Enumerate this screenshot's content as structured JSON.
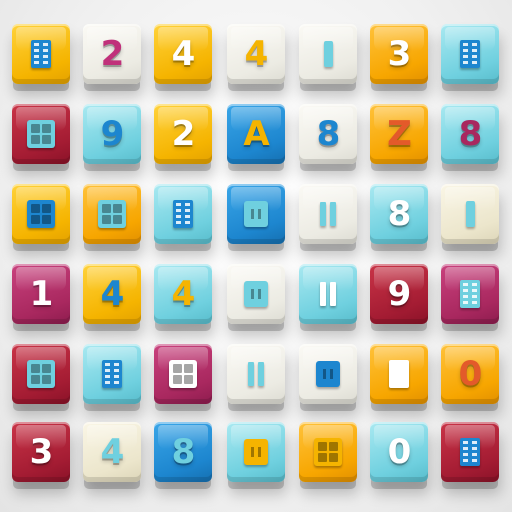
{
  "scene": {
    "background": "#f2f2f2",
    "palette": {
      "yellow": "#f5b400",
      "orange": "#f7a600",
      "cyan": "#6fd0df",
      "blue": "#1d86cf",
      "red": "#a41c33",
      "magenta": "#a9285f",
      "white": "#ecebe3",
      "cream": "#ece6cc"
    }
  },
  "tiles": [
    [
      {
        "color": "yellow",
        "glyph": "",
        "glyph_color": "#1d86cf",
        "icon": "grid-bars-icon"
      },
      {
        "color": "white",
        "glyph": "2",
        "glyph_color": "#c0307a",
        "icon": ""
      },
      {
        "color": "yellow",
        "glyph": "4",
        "glyph_color": "#ffffff",
        "icon": ""
      },
      {
        "color": "white",
        "glyph": "4",
        "glyph_color": "#f5b400",
        "icon": ""
      },
      {
        "color": "white",
        "glyph": "",
        "glyph_color": "#6fd0df",
        "icon": "single-bar-icon"
      },
      {
        "color": "orange",
        "glyph": "3",
        "glyph_color": "#ffffff",
        "icon": ""
      },
      {
        "color": "cyan",
        "glyph": "",
        "glyph_color": "#1d86cf",
        "icon": "grid-bars-icon"
      }
    ],
    [
      {
        "color": "red",
        "glyph": "",
        "glyph_color": "#6fd0df",
        "icon": "window-grid-icon"
      },
      {
        "color": "cyan",
        "glyph": "9",
        "glyph_color": "#1d86cf",
        "icon": ""
      },
      {
        "color": "yellow",
        "glyph": "2",
        "glyph_color": "#ffffff",
        "icon": ""
      },
      {
        "color": "blue",
        "glyph": "A",
        "glyph_color": "#f5b400",
        "icon": ""
      },
      {
        "color": "white",
        "glyph": "8",
        "glyph_color": "#1d86cf",
        "icon": ""
      },
      {
        "color": "orange",
        "glyph": "Z",
        "glyph_color": "#e35a2a",
        "icon": ""
      },
      {
        "color": "cyan",
        "glyph": "8",
        "glyph_color": "#a9285f",
        "icon": ""
      }
    ],
    [
      {
        "color": "yellow",
        "glyph": "",
        "glyph_color": "#1d86cf",
        "icon": "window-grid-icon"
      },
      {
        "color": "orange",
        "glyph": "",
        "glyph_color": "#6fd0df",
        "icon": "window-grid-icon"
      },
      {
        "color": "cyan",
        "glyph": "",
        "glyph_color": "#1d86cf",
        "icon": "grid-bars-icon"
      },
      {
        "color": "blue",
        "glyph": "",
        "glyph_color": "#6fd0df",
        "icon": "panel-icon"
      },
      {
        "color": "white",
        "glyph": "",
        "glyph_color": "#6fd0df",
        "icon": "double-bar-icon"
      },
      {
        "color": "cyan",
        "glyph": "8",
        "glyph_color": "#ffffff",
        "icon": ""
      },
      {
        "color": "cream",
        "glyph": "",
        "glyph_color": "#6fd0df",
        "icon": "single-bar-icon"
      }
    ],
    [
      {
        "color": "magenta",
        "glyph": "1",
        "glyph_color": "#ffffff",
        "icon": ""
      },
      {
        "color": "yellow",
        "glyph": "4",
        "glyph_color": "#1d86cf",
        "icon": ""
      },
      {
        "color": "cyan",
        "glyph": "4",
        "glyph_color": "#f5b400",
        "icon": ""
      },
      {
        "color": "white",
        "glyph": "",
        "glyph_color": "#6fd0df",
        "icon": "panel-icon"
      },
      {
        "color": "cyan",
        "glyph": "",
        "glyph_color": "#ffffff",
        "icon": "double-bar-icon"
      },
      {
        "color": "red",
        "glyph": "9",
        "glyph_color": "#ffffff",
        "icon": ""
      },
      {
        "color": "magenta",
        "glyph": "",
        "glyph_color": "#6fd0df",
        "icon": "grid-bars-icon"
      }
    ],
    [
      {
        "color": "red",
        "glyph": "",
        "glyph_color": "#6fd0df",
        "icon": "window-grid-icon"
      },
      {
        "color": "cyan",
        "glyph": "",
        "glyph_color": "#1d86cf",
        "icon": "grid-bars-icon"
      },
      {
        "color": "magenta",
        "glyph": "",
        "glyph_color": "#ffffff",
        "icon": "window-grid-icon"
      },
      {
        "color": "white",
        "glyph": "",
        "glyph_color": "#6fd0df",
        "icon": "double-bar-icon"
      },
      {
        "color": "white",
        "glyph": "",
        "glyph_color": "#1d86cf",
        "icon": "panel-icon"
      },
      {
        "color": "orange",
        "glyph": "",
        "glyph_color": "#ffffff",
        "icon": "grid-bars-icon"
      },
      {
        "color": "orange",
        "glyph": "0",
        "glyph_color": "#e35a2a",
        "icon": ""
      }
    ],
    [
      {
        "color": "red",
        "glyph": "3",
        "glyph_color": "#ffffff",
        "icon": ""
      },
      {
        "color": "cream",
        "glyph": "4",
        "glyph_color": "#6fd0df",
        "icon": ""
      },
      {
        "color": "blue",
        "glyph": "8",
        "glyph_color": "#6fd0df",
        "icon": ""
      },
      {
        "color": "cyan",
        "glyph": "",
        "glyph_color": "#f5b400",
        "icon": "panel-icon"
      },
      {
        "color": "orange",
        "glyph": "",
        "glyph_color": "#f5b400",
        "icon": "window-grid-icon"
      },
      {
        "color": "cyan",
        "glyph": "0",
        "glyph_color": "#ffffff",
        "icon": ""
      },
      {
        "color": "red",
        "glyph": "",
        "glyph_color": "#1d86cf",
        "icon": "grid-bars-icon"
      }
    ]
  ]
}
